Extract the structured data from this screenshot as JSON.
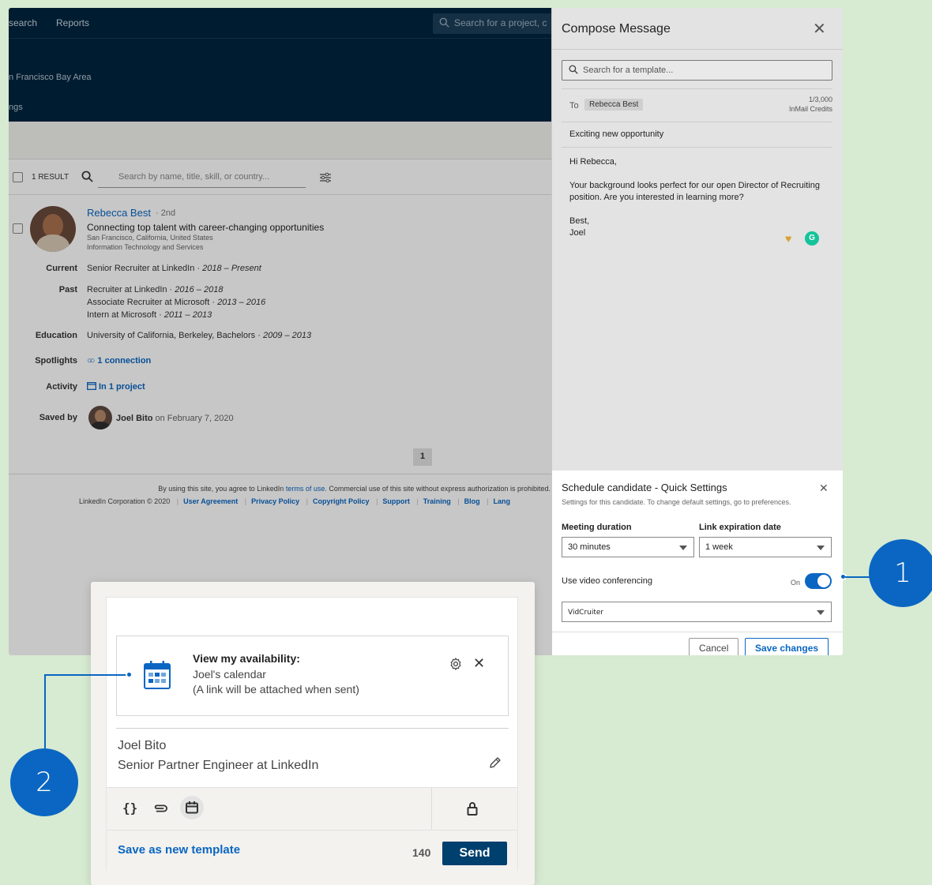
{
  "nav": {
    "links": [
      "search",
      "Reports"
    ],
    "top_search_placeholder": "Search for a project, c",
    "location": "n Francisco Bay Area",
    "sub_item": "ngs"
  },
  "results": {
    "count_label": "1 RESULT",
    "search_placeholder": "Search by name, title, skill, or country..."
  },
  "candidate": {
    "name": "Rebecca Best",
    "degree": "· 2nd",
    "headline": "Connecting top talent with career-changing opportunities",
    "location": "San Francisco, California, United States",
    "industry": "Information Technology and Services",
    "current_label": "Current",
    "current": "Senior Recruiter at LinkedIn ·",
    "current_dates": "2018 – Present",
    "past_label": "Past",
    "past": [
      {
        "role": "Recruiter at LinkedIn ·",
        "dates": "2016 – 2018"
      },
      {
        "role": "Associate Recruiter at Microsoft ·",
        "dates": "2013 – 2016"
      },
      {
        "role": "Intern at Microsoft ·",
        "dates": "2011 – 2013"
      }
    ],
    "education_label": "Education",
    "education": "University of California, Berkeley, Bachelors ·",
    "education_dates": "2009 – 2013",
    "spotlights_label": "Spotlights",
    "spotlights": "1 connection",
    "activity_label": "Activity",
    "activity": "In 1 project",
    "saved_label": "Saved by",
    "saved_by": "Joel Bito",
    "saved_on": "on February 7, 2020"
  },
  "pagination": {
    "page": "1"
  },
  "footer": {
    "line1_a": "By using this site, you agree to LinkedIn",
    "line1_link": "terms of use.",
    "line1_b": "Commercial use of this site without express authorization is prohibited.",
    "copyright": "LinkedIn Corporation © 2020",
    "links": [
      "User Agreement",
      "Privacy Policy",
      "Copyright Policy",
      "Support",
      "Training",
      "Blog",
      "Lang"
    ]
  },
  "compose": {
    "title": "Compose Message",
    "template_search": "Search for a template...",
    "to_label": "To",
    "recipient": "Rebecca Best",
    "credits_count": "1/3,000",
    "credits_label": "InMail Credits",
    "subject": "Exciting new opportunity",
    "body": "Hi Rebecca,\n\nYour background looks perfect for our open Director of Recruiting position. Are you interested in learning more?\n\nBest,\nJoel"
  },
  "quick_settings": {
    "title": "Schedule candidate - Quick Settings",
    "subtitle": "Settings for this candidate. To change default settings, go to preferences.",
    "duration_label": "Meeting duration",
    "duration_value": "30 minutes",
    "expiration_label": "Link expiration date",
    "expiration_value": "1 week",
    "video_label": "Use video conferencing",
    "toggle_state": "On",
    "provider": "VidCruiter",
    "cancel": "Cancel",
    "save": "Save changes"
  },
  "callouts": {
    "one": "1",
    "two": "2"
  },
  "zoom": {
    "availability_title": "View my availability:",
    "calendar_name": "Joel's calendar",
    "link_note": "(A link will be attached when sent)",
    "sender_name": "Joel Bito",
    "sender_title": "Senior Partner Engineer at LinkedIn",
    "save_template": "Save as new template",
    "char_count": "140",
    "send": "Send"
  },
  "colors": {
    "accent": "#0a66c2",
    "navy": "#00253f",
    "send": "#00406e",
    "background": "#d7ead2"
  }
}
